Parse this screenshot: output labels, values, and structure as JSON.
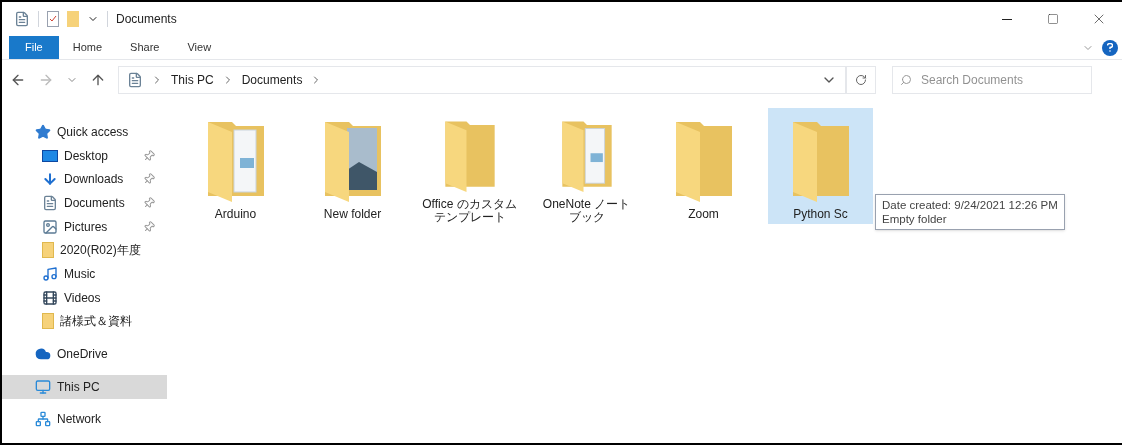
{
  "window": {
    "title": "Documents"
  },
  "ribbon_tabs": [
    {
      "label": "File",
      "selected": true
    },
    {
      "label": "Home",
      "selected": false
    },
    {
      "label": "Share",
      "selected": false
    },
    {
      "label": "View",
      "selected": false
    }
  ],
  "address": {
    "crumbs": [
      "This PC",
      "Documents"
    ]
  },
  "search": {
    "placeholder": "Search Documents"
  },
  "sidebar": {
    "items": [
      {
        "label": "Quick access",
        "kind": "star",
        "pinned": false,
        "selected": false,
        "group_start": true
      },
      {
        "label": "Desktop",
        "kind": "desktop",
        "pinned": true,
        "selected": false,
        "group_start": false
      },
      {
        "label": "Downloads",
        "kind": "download",
        "pinned": true,
        "selected": false,
        "group_start": false
      },
      {
        "label": "Documents",
        "kind": "document",
        "pinned": true,
        "selected": false,
        "group_start": false
      },
      {
        "label": "Pictures",
        "kind": "pictures",
        "pinned": true,
        "selected": false,
        "group_start": false
      },
      {
        "label": "2020(R02)年度",
        "kind": "folder",
        "pinned": false,
        "selected": false,
        "group_start": false
      },
      {
        "label": "Music",
        "kind": "music",
        "pinned": false,
        "selected": false,
        "group_start": false
      },
      {
        "label": "Videos",
        "kind": "video",
        "pinned": false,
        "selected": false,
        "group_start": false
      },
      {
        "label": "諸様式＆資料",
        "kind": "folder",
        "pinned": false,
        "selected": false,
        "group_start": false
      },
      {
        "label": "OneDrive",
        "kind": "cloud",
        "pinned": false,
        "selected": false,
        "group_start": true
      },
      {
        "label": "This PC",
        "kind": "pc",
        "pinned": false,
        "selected": true,
        "group_start": true
      },
      {
        "label": "Network",
        "kind": "network",
        "pinned": false,
        "selected": false,
        "group_start": true
      }
    ]
  },
  "folders": [
    {
      "name": "Arduino",
      "kind": "documents",
      "selected": false
    },
    {
      "name": "New folder",
      "kind": "picture",
      "selected": false
    },
    {
      "name": "Office のカスタムテンプレート",
      "kind": "plain",
      "selected": false
    },
    {
      "name": "OneNote ノートブック",
      "kind": "documents",
      "selected": false
    },
    {
      "name": "Zoom",
      "kind": "plain",
      "selected": false
    },
    {
      "name": "Python Sc",
      "kind": "plain",
      "selected": true
    }
  ],
  "tooltip": {
    "lines": [
      "Date created: 9/24/2021 12:26 PM",
      "Empty folder"
    ]
  }
}
